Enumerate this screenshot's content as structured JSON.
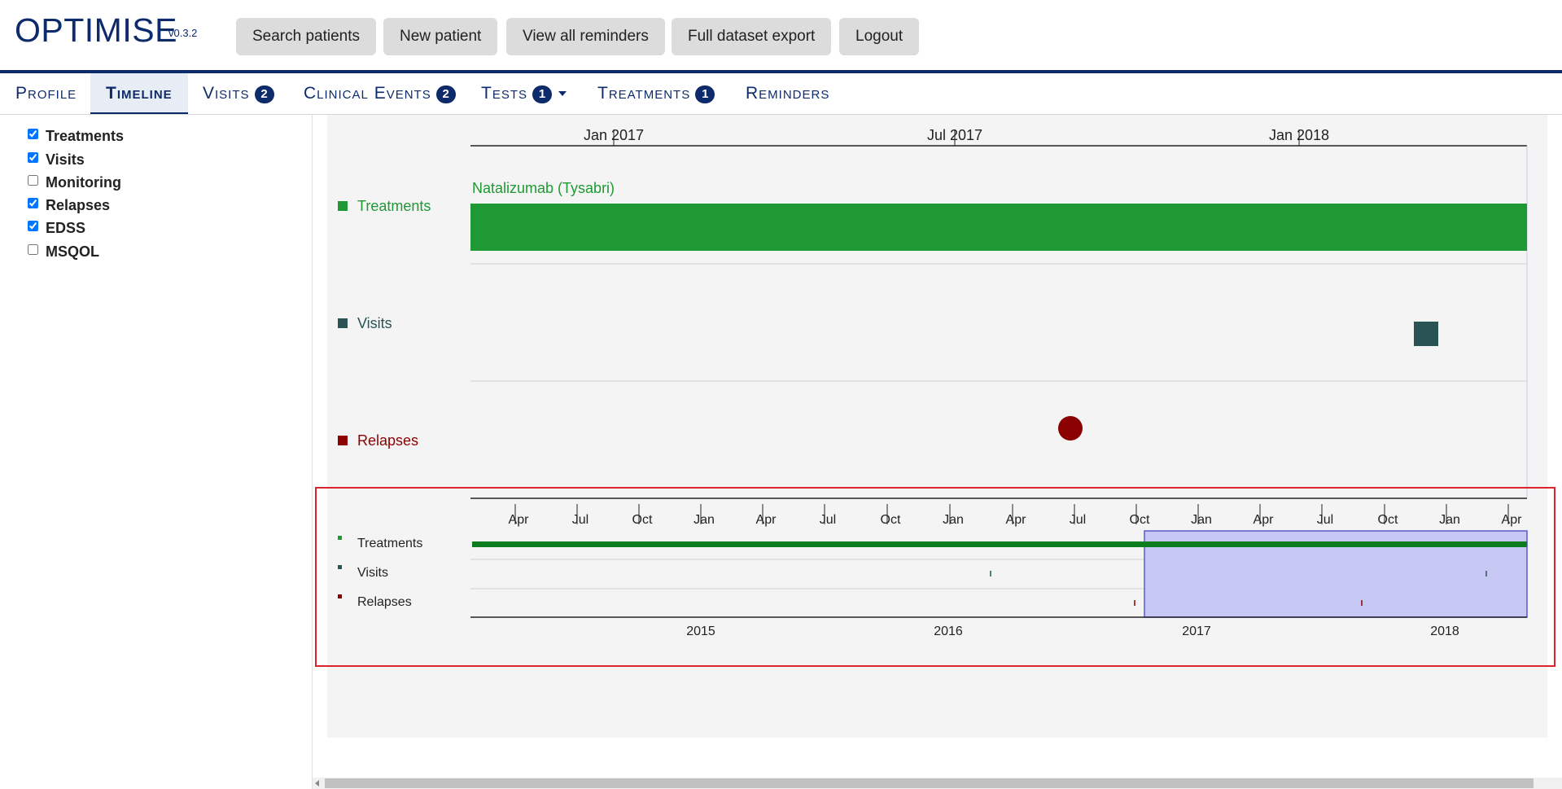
{
  "app": {
    "title": "OPTIMISE",
    "version": "v0.3.2"
  },
  "topnav": {
    "search_patients": "Search patients",
    "new_patient": "New patient",
    "view_all_reminders": "View all reminders",
    "full_dataset_export": "Full dataset export",
    "logout": "Logout"
  },
  "tabs": {
    "profile": {
      "label": "Profile"
    },
    "timeline": {
      "label": "Timeline"
    },
    "visits": {
      "label": "Visits",
      "count": "2"
    },
    "clinical_events": {
      "label": "Clinical Events",
      "count": "2"
    },
    "tests": {
      "label": "Tests",
      "count": "1"
    },
    "treatments": {
      "label": "Treatments",
      "count": "1"
    },
    "reminders": {
      "label": "Reminders"
    }
  },
  "filters": [
    {
      "label": "Treatments",
      "checked": true
    },
    {
      "label": "Visits",
      "checked": true
    },
    {
      "label": "Monitoring",
      "checked": false
    },
    {
      "label": "Relapses",
      "checked": true
    },
    {
      "label": "EDSS",
      "checked": true
    },
    {
      "label": "MSQOL",
      "checked": false
    }
  ],
  "colors": {
    "brand": "#0d2b6b",
    "treatments": "#1e9933",
    "treatments_overview": "#0b7d1e",
    "visits": "#2a5453",
    "relapses": "#8b0000",
    "selection": "#c8c8f4",
    "selection_border": "#5a5ad0",
    "highlight_box": "#d9252b"
  },
  "timeline": {
    "main_axis_ticks": [
      "Jan 2017",
      "Jul 2017",
      "Jan 2018"
    ],
    "rows": [
      {
        "key": "treatments",
        "label": "Treatments"
      },
      {
        "key": "visits",
        "label": "Visits"
      },
      {
        "key": "relapses",
        "label": "Relapses"
      }
    ],
    "treatment_name": "Natalizumab (Tysabri)",
    "overview": {
      "top_ticks": [
        "Apr",
        "Jul",
        "Oct",
        "Jan",
        "Apr",
        "Jul",
        "Oct",
        "Jan",
        "Apr",
        "Jul",
        "Oct",
        "Jan",
        "Apr",
        "Jul",
        "Oct",
        "Jan",
        "Apr"
      ],
      "bottom_ticks": [
        "2015",
        "2016",
        "2017",
        "2018"
      ]
    }
  }
}
